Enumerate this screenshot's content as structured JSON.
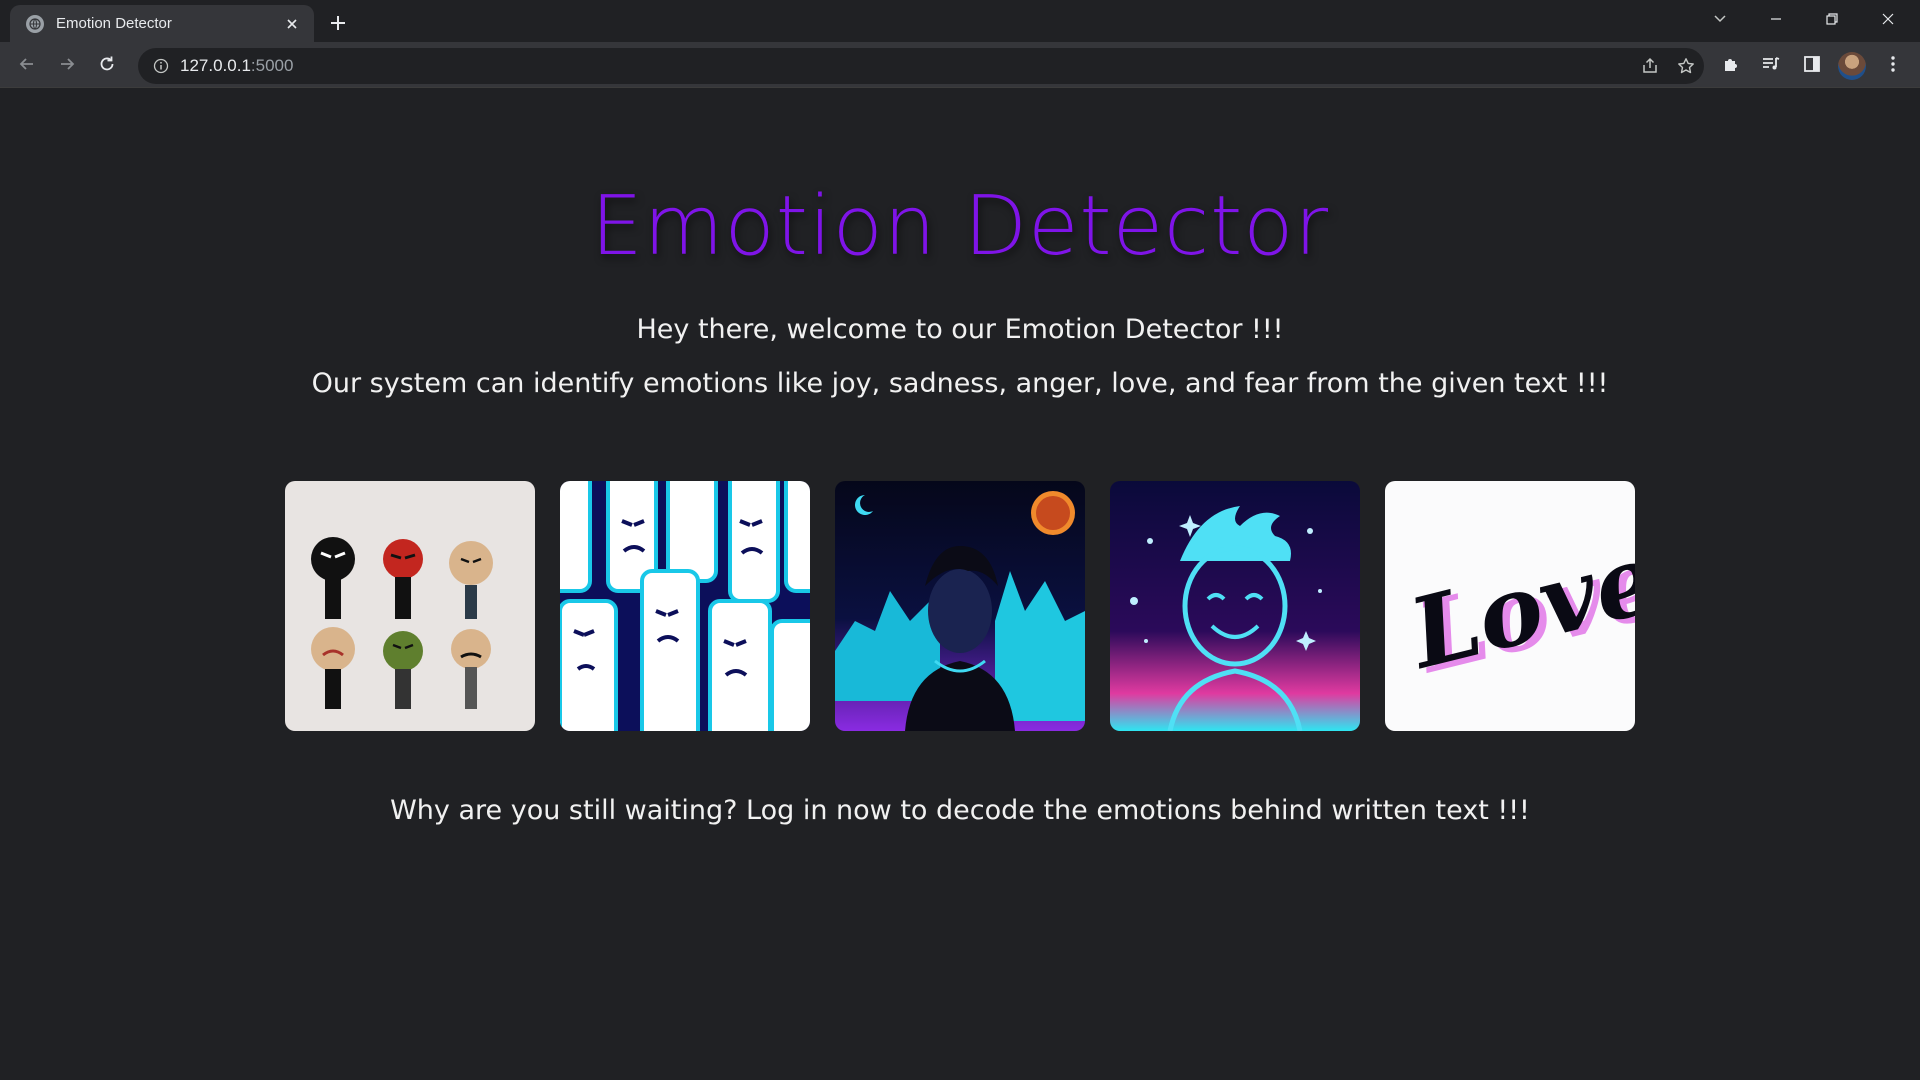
{
  "browser": {
    "tab_title": "Emotion Detector",
    "url_host": "127.0.0.1",
    "url_port": ":5000"
  },
  "page": {
    "title": "Emotion Detector",
    "intro_line_1": "Hey there, welcome to our Emotion Detector !!!",
    "intro_line_2": "Our system can identify emotions like joy, sadness, anger, love, and fear from the given text !!!",
    "cta": "Why are you still waiting? Log in now to decode the emotions behind written text !!!",
    "title_color": "#7f14e8",
    "cards_text": {
      "love": "Love"
    }
  },
  "icons": {
    "tab": [
      "globe-icon",
      "close-icon",
      "plus-icon"
    ],
    "window": [
      "chevron-down-icon",
      "minimize-icon",
      "restore-icon",
      "close-icon"
    ],
    "toolbar": [
      "back-icon",
      "forward-icon",
      "reload-icon",
      "info-icon",
      "share-icon",
      "star-icon",
      "puzzle-icon",
      "media-icon",
      "sidepanel-icon",
      "kebab-menu-icon"
    ]
  }
}
